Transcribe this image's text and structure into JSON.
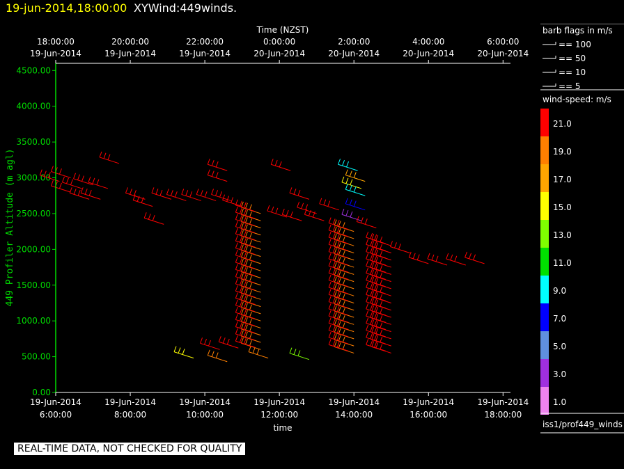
{
  "header": {
    "date": "19-jun-2014,18:00:00",
    "title": "XYWind:449winds."
  },
  "chart_data": {
    "type": "wind-barb",
    "ylabel": "449 Profiler Altitude (m agl)",
    "xlabel": "time",
    "top_axis_label": "Time (NZST)",
    "ylim": [
      0,
      4600
    ],
    "yticks": [
      "0.00",
      "500.00",
      "1000.00",
      "1500.00",
      "2000.00",
      "2500.00",
      "3000.00",
      "3500.00",
      "4000.00",
      "4500.00"
    ],
    "xlim_hours": [
      6,
      18.2
    ],
    "bottom_ticks": [
      {
        "date": "19-Jun-2014",
        "time": "6:00:00",
        "h": 6
      },
      {
        "date": "19-Jun-2014",
        "time": "8:00:00",
        "h": 8
      },
      {
        "date": "19-Jun-2014",
        "time": "10:00:00",
        "h": 10
      },
      {
        "date": "19-Jun-2014",
        "time": "12:00:00",
        "h": 12
      },
      {
        "date": "19-Jun-2014",
        "time": "14:00:00",
        "h": 14
      },
      {
        "date": "19-Jun-2014",
        "time": "16:00:00",
        "h": 16
      },
      {
        "date": "19-Jun-2014",
        "time": "18:00:00",
        "h": 18
      }
    ],
    "top_ticks": [
      {
        "time": "18:00:00",
        "date": "19-Jun-2014",
        "h": 6
      },
      {
        "time": "20:00:00",
        "date": "19-Jun-2014",
        "h": 8
      },
      {
        "time": "22:00:00",
        "date": "19-Jun-2014",
        "h": 10
      },
      {
        "time": "0:00:00",
        "date": "20-Jun-2014",
        "h": 12
      },
      {
        "time": "2:00:00",
        "date": "20-Jun-2014",
        "h": 14
      },
      {
        "time": "4:00:00",
        "date": "20-Jun-2014",
        "h": 16
      },
      {
        "time": "6:00:00",
        "date": "20-Jun-2014",
        "h": 18
      }
    ],
    "dense_columns": [
      {
        "h": 11.5,
        "from": 600,
        "to": 2550,
        "step": 100,
        "speed": 19
      },
      {
        "h": 14.0,
        "from": 550,
        "to": 2250,
        "step": 100,
        "speed": 18
      },
      {
        "h": 15.0,
        "from": 550,
        "to": 2050,
        "step": 100,
        "speed": 20
      }
    ],
    "scattered": [
      {
        "h": 6.1,
        "alt": 2950,
        "speed": 21
      },
      {
        "h": 6.4,
        "alt": 3000,
        "speed": 21
      },
      {
        "h": 6.4,
        "alt": 2800,
        "speed": 21
      },
      {
        "h": 6.7,
        "alt": 2850,
        "speed": 21
      },
      {
        "h": 7.0,
        "alt": 2900,
        "speed": 21
      },
      {
        "h": 6.9,
        "alt": 2700,
        "speed": 21
      },
      {
        "h": 7.4,
        "alt": 2850,
        "speed": 21
      },
      {
        "h": 7.2,
        "alt": 2700,
        "speed": 21
      },
      {
        "h": 7.7,
        "alt": 3200,
        "speed": 21
      },
      {
        "h": 8.4,
        "alt": 2700,
        "speed": 21
      },
      {
        "h": 8.6,
        "alt": 2600,
        "speed": 21
      },
      {
        "h": 8.9,
        "alt": 2350,
        "speed": 21
      },
      {
        "h": 9.1,
        "alt": 2700,
        "speed": 21
      },
      {
        "h": 9.5,
        "alt": 2680,
        "speed": 21
      },
      {
        "h": 9.9,
        "alt": 2680,
        "speed": 21
      },
      {
        "h": 10.3,
        "alt": 2680,
        "speed": 21
      },
      {
        "h": 10.7,
        "alt": 2680,
        "speed": 21
      },
      {
        "h": 10.6,
        "alt": 3100,
        "speed": 21
      },
      {
        "h": 10.6,
        "alt": 2950,
        "speed": 21
      },
      {
        "h": 11.0,
        "alt": 2600,
        "speed": 21
      },
      {
        "h": 12.3,
        "alt": 3100,
        "speed": 21
      },
      {
        "h": 12.2,
        "alt": 2450,
        "speed": 21
      },
      {
        "h": 12.6,
        "alt": 2400,
        "speed": 21
      },
      {
        "h": 12.8,
        "alt": 2700,
        "speed": 21
      },
      {
        "h": 13.0,
        "alt": 2500,
        "speed": 21
      },
      {
        "h": 13.2,
        "alt": 2400,
        "speed": 21
      },
      {
        "h": 13.6,
        "alt": 2550,
        "speed": 21
      },
      {
        "h": 14.1,
        "alt": 3100,
        "speed": 9
      },
      {
        "h": 14.3,
        "alt": 2950,
        "speed": 17
      },
      {
        "h": 14.2,
        "alt": 2850,
        "speed": 15
      },
      {
        "h": 14.3,
        "alt": 2750,
        "speed": 9
      },
      {
        "h": 14.3,
        "alt": 2550,
        "speed": 7
      },
      {
        "h": 14.2,
        "alt": 2400,
        "speed": 3
      },
      {
        "h": 14.6,
        "alt": 2300,
        "speed": 21
      },
      {
        "h": 15.5,
        "alt": 1950,
        "speed": 21
      },
      {
        "h": 16.0,
        "alt": 1800,
        "speed": 21
      },
      {
        "h": 16.5,
        "alt": 1780,
        "speed": 21
      },
      {
        "h": 17.0,
        "alt": 1780,
        "speed": 21
      },
      {
        "h": 17.5,
        "alt": 1800,
        "speed": 21
      },
      {
        "h": 9.7,
        "alt": 480,
        "speed": 15
      },
      {
        "h": 10.4,
        "alt": 600,
        "speed": 21
      },
      {
        "h": 10.6,
        "alt": 430,
        "speed": 19
      },
      {
        "h": 10.9,
        "alt": 620,
        "speed": 21
      },
      {
        "h": 11.7,
        "alt": 480,
        "speed": 19
      },
      {
        "h": 12.8,
        "alt": 460,
        "speed": 13
      }
    ]
  },
  "legend": {
    "flags_title": "barb flags in m/s",
    "flags": [
      "== 100",
      "== 50",
      "== 10",
      "== 5"
    ],
    "speed_title": "wind-speed: m/s",
    "scale": [
      {
        "label": "21.0",
        "color": "#ff0000"
      },
      {
        "label": "19.0",
        "color": "#ff7f00"
      },
      {
        "label": "17.0",
        "color": "#ffa500"
      },
      {
        "label": "15.0",
        "color": "#ffff00"
      },
      {
        "label": "13.0",
        "color": "#7fff00"
      },
      {
        "label": "11.0",
        "color": "#00e000"
      },
      {
        "label": "9.0",
        "color": "#00ffff"
      },
      {
        "label": "7.0",
        "color": "#0000ff"
      },
      {
        "label": "5.0",
        "color": "#5f8fdf"
      },
      {
        "label": "3.0",
        "color": "#9f2fdf"
      },
      {
        "label": "1.0",
        "color": "#ee82ee"
      }
    ],
    "source": "iss1/prof449_winds"
  },
  "disclaimer": "REAL-TIME DATA, NOT CHECKED FOR QUALITY"
}
